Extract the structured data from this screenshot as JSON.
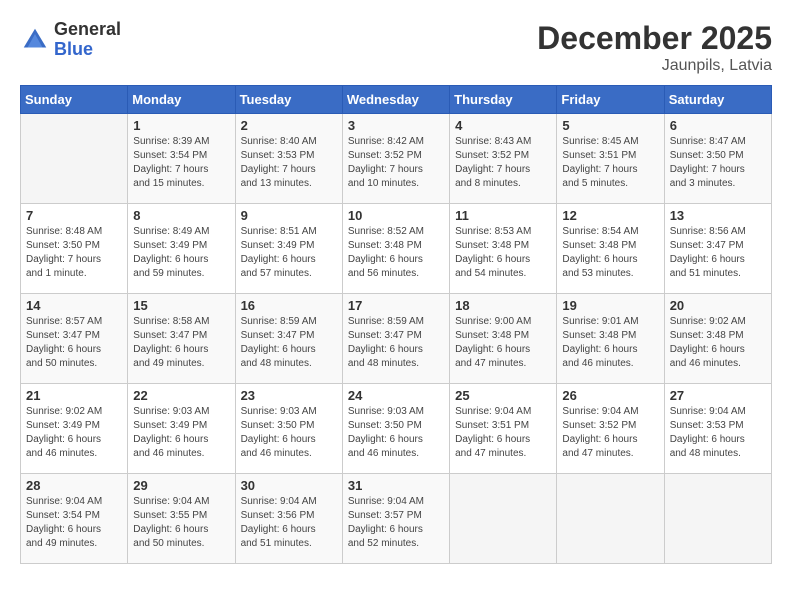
{
  "logo": {
    "general": "General",
    "blue": "Blue"
  },
  "header": {
    "month": "December 2025",
    "location": "Jaunpils, Latvia"
  },
  "days_of_week": [
    "Sunday",
    "Monday",
    "Tuesday",
    "Wednesday",
    "Thursday",
    "Friday",
    "Saturday"
  ],
  "weeks": [
    [
      {
        "day": "",
        "info": ""
      },
      {
        "day": "1",
        "info": "Sunrise: 8:39 AM\nSunset: 3:54 PM\nDaylight: 7 hours\nand 15 minutes."
      },
      {
        "day": "2",
        "info": "Sunrise: 8:40 AM\nSunset: 3:53 PM\nDaylight: 7 hours\nand 13 minutes."
      },
      {
        "day": "3",
        "info": "Sunrise: 8:42 AM\nSunset: 3:52 PM\nDaylight: 7 hours\nand 10 minutes."
      },
      {
        "day": "4",
        "info": "Sunrise: 8:43 AM\nSunset: 3:52 PM\nDaylight: 7 hours\nand 8 minutes."
      },
      {
        "day": "5",
        "info": "Sunrise: 8:45 AM\nSunset: 3:51 PM\nDaylight: 7 hours\nand 5 minutes."
      },
      {
        "day": "6",
        "info": "Sunrise: 8:47 AM\nSunset: 3:50 PM\nDaylight: 7 hours\nand 3 minutes."
      }
    ],
    [
      {
        "day": "7",
        "info": "Sunrise: 8:48 AM\nSunset: 3:50 PM\nDaylight: 7 hours\nand 1 minute."
      },
      {
        "day": "8",
        "info": "Sunrise: 8:49 AM\nSunset: 3:49 PM\nDaylight: 6 hours\nand 59 minutes."
      },
      {
        "day": "9",
        "info": "Sunrise: 8:51 AM\nSunset: 3:49 PM\nDaylight: 6 hours\nand 57 minutes."
      },
      {
        "day": "10",
        "info": "Sunrise: 8:52 AM\nSunset: 3:48 PM\nDaylight: 6 hours\nand 56 minutes."
      },
      {
        "day": "11",
        "info": "Sunrise: 8:53 AM\nSunset: 3:48 PM\nDaylight: 6 hours\nand 54 minutes."
      },
      {
        "day": "12",
        "info": "Sunrise: 8:54 AM\nSunset: 3:48 PM\nDaylight: 6 hours\nand 53 minutes."
      },
      {
        "day": "13",
        "info": "Sunrise: 8:56 AM\nSunset: 3:47 PM\nDaylight: 6 hours\nand 51 minutes."
      }
    ],
    [
      {
        "day": "14",
        "info": "Sunrise: 8:57 AM\nSunset: 3:47 PM\nDaylight: 6 hours\nand 50 minutes."
      },
      {
        "day": "15",
        "info": "Sunrise: 8:58 AM\nSunset: 3:47 PM\nDaylight: 6 hours\nand 49 minutes."
      },
      {
        "day": "16",
        "info": "Sunrise: 8:59 AM\nSunset: 3:47 PM\nDaylight: 6 hours\nand 48 minutes."
      },
      {
        "day": "17",
        "info": "Sunrise: 8:59 AM\nSunset: 3:47 PM\nDaylight: 6 hours\nand 48 minutes."
      },
      {
        "day": "18",
        "info": "Sunrise: 9:00 AM\nSunset: 3:48 PM\nDaylight: 6 hours\nand 47 minutes."
      },
      {
        "day": "19",
        "info": "Sunrise: 9:01 AM\nSunset: 3:48 PM\nDaylight: 6 hours\nand 46 minutes."
      },
      {
        "day": "20",
        "info": "Sunrise: 9:02 AM\nSunset: 3:48 PM\nDaylight: 6 hours\nand 46 minutes."
      }
    ],
    [
      {
        "day": "21",
        "info": "Sunrise: 9:02 AM\nSunset: 3:49 PM\nDaylight: 6 hours\nand 46 minutes."
      },
      {
        "day": "22",
        "info": "Sunrise: 9:03 AM\nSunset: 3:49 PM\nDaylight: 6 hours\nand 46 minutes."
      },
      {
        "day": "23",
        "info": "Sunrise: 9:03 AM\nSunset: 3:50 PM\nDaylight: 6 hours\nand 46 minutes."
      },
      {
        "day": "24",
        "info": "Sunrise: 9:03 AM\nSunset: 3:50 PM\nDaylight: 6 hours\nand 46 minutes."
      },
      {
        "day": "25",
        "info": "Sunrise: 9:04 AM\nSunset: 3:51 PM\nDaylight: 6 hours\nand 47 minutes."
      },
      {
        "day": "26",
        "info": "Sunrise: 9:04 AM\nSunset: 3:52 PM\nDaylight: 6 hours\nand 47 minutes."
      },
      {
        "day": "27",
        "info": "Sunrise: 9:04 AM\nSunset: 3:53 PM\nDaylight: 6 hours\nand 48 minutes."
      }
    ],
    [
      {
        "day": "28",
        "info": "Sunrise: 9:04 AM\nSunset: 3:54 PM\nDaylight: 6 hours\nand 49 minutes."
      },
      {
        "day": "29",
        "info": "Sunrise: 9:04 AM\nSunset: 3:55 PM\nDaylight: 6 hours\nand 50 minutes."
      },
      {
        "day": "30",
        "info": "Sunrise: 9:04 AM\nSunset: 3:56 PM\nDaylight: 6 hours\nand 51 minutes."
      },
      {
        "day": "31",
        "info": "Sunrise: 9:04 AM\nSunset: 3:57 PM\nDaylight: 6 hours\nand 52 minutes."
      },
      {
        "day": "",
        "info": ""
      },
      {
        "day": "",
        "info": ""
      },
      {
        "day": "",
        "info": ""
      }
    ]
  ]
}
